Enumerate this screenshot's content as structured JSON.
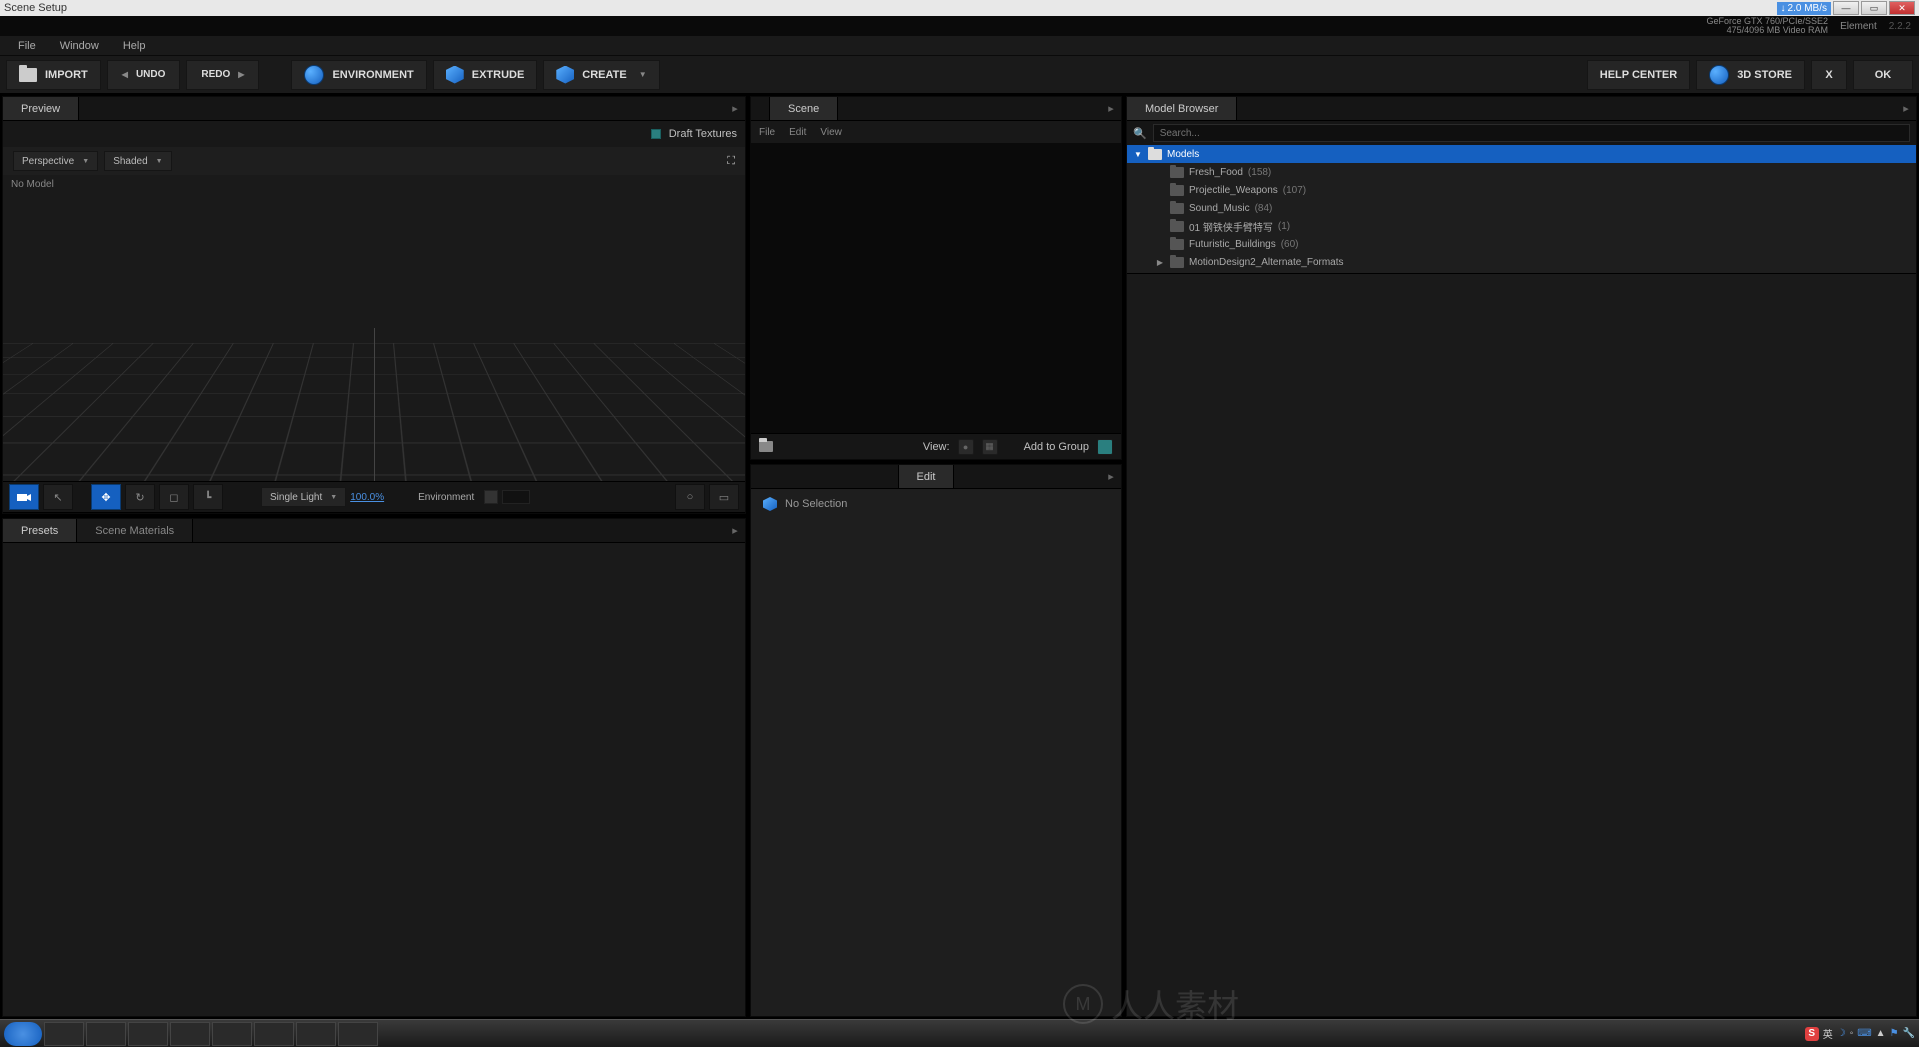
{
  "titlebar": {
    "title": "Scene Setup",
    "speed": "2.0 MB/s"
  },
  "sysinfo": {
    "gpu_line1": "GeForce GTX 760/PCIe/SSE2",
    "gpu_line2": "475/4096 MB Video RAM",
    "app": "Element",
    "version": "2.2.2"
  },
  "menubar": {
    "items": [
      "File",
      "Window",
      "Help"
    ]
  },
  "toolbar": {
    "import": "IMPORT",
    "undo": "UNDO",
    "redo": "REDO",
    "environment": "ENVIRONMENT",
    "extrude": "EXTRUDE",
    "create": "CREATE",
    "help_center": "HELP CENTER",
    "store": "3D STORE",
    "x": "X",
    "ok": "OK"
  },
  "preview": {
    "tab": "Preview",
    "draft_textures": "Draft Textures",
    "mode1": "Perspective",
    "mode2": "Shaded",
    "no_model": "No Model",
    "light_mode": "Single Light",
    "zoom": "100.0%",
    "env_label": "Environment"
  },
  "presets": {
    "tab1": "Presets",
    "tab2": "Scene Materials"
  },
  "scene": {
    "tab": "Scene",
    "menu": [
      "File",
      "Edit",
      "View"
    ],
    "view_label": "View:",
    "add_to_group": "Add to Group"
  },
  "edit": {
    "tab": "Edit",
    "no_selection": "No Selection"
  },
  "browser": {
    "tab": "Model Browser",
    "search_placeholder": "Search...",
    "root": "Models",
    "items": [
      {
        "name": "Fresh_Food",
        "count": "(158)",
        "expandable": false
      },
      {
        "name": "Projectile_Weapons",
        "count": "(107)",
        "expandable": false
      },
      {
        "name": "Sound_Music",
        "count": "(84)",
        "expandable": false
      },
      {
        "name": "01 钢铁侠手臂特写",
        "count": "(1)",
        "expandable": false
      },
      {
        "name": "Futuristic_Buildings",
        "count": "(60)",
        "expandable": false
      },
      {
        "name": "MotionDesign2_Alternate_Formats",
        "count": "",
        "expandable": true
      }
    ]
  },
  "taskbar": {
    "ime": "英",
    "watermark": "人人素材"
  }
}
